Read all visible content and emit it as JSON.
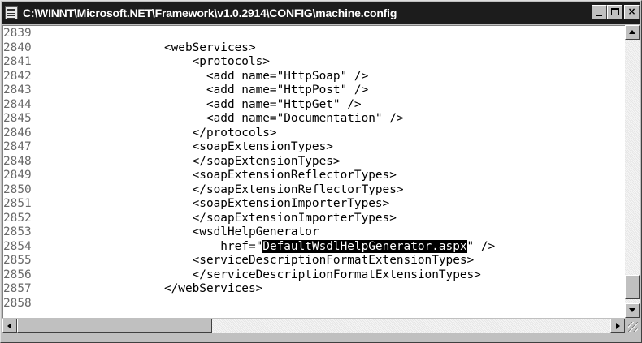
{
  "window": {
    "title": "C:\\WINNT\\Microsoft.NET\\Framework\\v1.0.2914\\CONFIG\\machine.config",
    "icon": "document-icon",
    "buttons": {
      "minimize": "minimize-icon",
      "maximize": "maximize-icon",
      "close": "×"
    }
  },
  "editor": {
    "lines": [
      {
        "num": "2839",
        "text": ""
      },
      {
        "num": "2840",
        "text": "<webServices>"
      },
      {
        "num": "2841",
        "text": "    <protocols>"
      },
      {
        "num": "2842",
        "text": "      <add name=\"HttpSoap\" />"
      },
      {
        "num": "2843",
        "text": "      <add name=\"HttpPost\" />"
      },
      {
        "num": "2844",
        "text": "      <add name=\"HttpGet\" />"
      },
      {
        "num": "2845",
        "text": "      <add name=\"Documentation\" />"
      },
      {
        "num": "2846",
        "text": "    </protocols>"
      },
      {
        "num": "2847",
        "text": "    <soapExtensionTypes>"
      },
      {
        "num": "2848",
        "text": "    </soapExtensionTypes>"
      },
      {
        "num": "2849",
        "text": "    <soapExtensionReflectorTypes>"
      },
      {
        "num": "2850",
        "text": "    </soapExtensionReflectorTypes>"
      },
      {
        "num": "2851",
        "text": "    <soapExtensionImporterTypes>"
      },
      {
        "num": "2852",
        "text": "    </soapExtensionImporterTypes>"
      },
      {
        "num": "2853",
        "text": "    <wsdlHelpGenerator"
      },
      {
        "num": "2854",
        "text": "        href=\"",
        "selected": "DefaultWsdlHelpGenerator.aspx",
        "after": "\" />"
      },
      {
        "num": "2855",
        "text": "    <serviceDescriptionFormatExtensionTypes>"
      },
      {
        "num": "2856",
        "text": "    </serviceDescriptionFormatExtensionTypes>"
      },
      {
        "num": "2857",
        "text": "</webServices>"
      },
      {
        "num": "2858",
        "text": ""
      }
    ],
    "selection_color": "#000000"
  },
  "scrollbars": {
    "vertical_position": 0.85,
    "horizontal_position": 0.0
  }
}
